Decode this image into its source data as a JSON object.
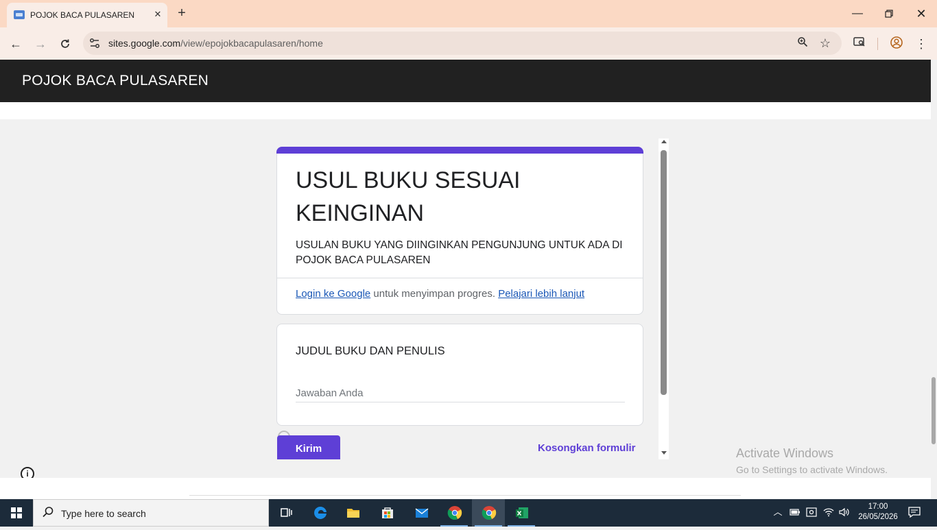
{
  "browser": {
    "tab_title": "POJOK BACA PULASAREN",
    "url_domain": "sites.google.com",
    "url_path": "/view/epojokbacapulasaren/home"
  },
  "site": {
    "title": "POJOK BACA PULASAREN"
  },
  "form": {
    "title": "USUL BUKU SESUAI KEINGINAN",
    "description": "USULAN BUKU YANG DIINGINKAN PENGUNJUNG UNTUK ADA DI POJOK BACA PULASAREN",
    "login_link": "Login ke Google",
    "login_text": " untuk menyimpan progres. ",
    "learn_more_link": "Pelajari lebih lanjut",
    "question_label": "JUDUL BUKU DAN PENULIS",
    "answer_placeholder": "Jawaban Anda",
    "submit_label": "Kirim",
    "clear_label": "Kosongkan formulir",
    "accent_color": "#5e3fd6"
  },
  "watermark": {
    "title": "Activate Windows",
    "subtitle": "Go to Settings to activate Windows."
  },
  "taskbar": {
    "search_placeholder": "Type here to search",
    "time": "17:00",
    "date": "26/05/2026"
  }
}
